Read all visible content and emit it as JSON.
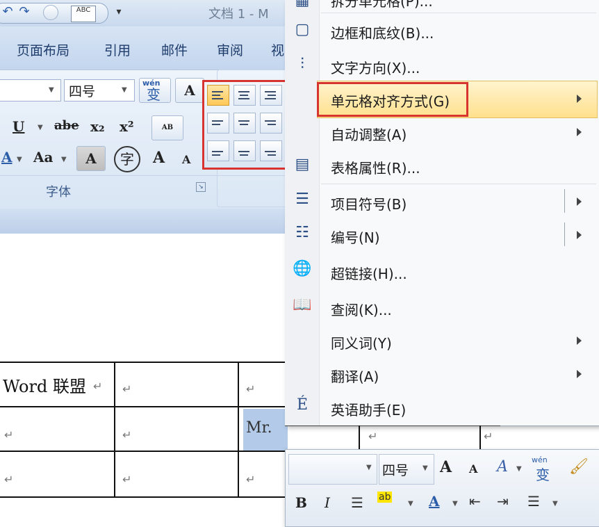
{
  "window": {
    "title": "文档 1 - M",
    "qat_undo": "↶",
    "qat_redo": "↷",
    "qat_more": "▾",
    "qat_abc": "ABC"
  },
  "tabs": [
    "页面布局",
    "引用",
    "邮件",
    "审阅",
    "视"
  ],
  "ribbon": {
    "font_size": "四号",
    "phonetic_guide": "wén",
    "phonetic_char": "变",
    "char_border": "A",
    "underline": "U",
    "strike": "abe",
    "subscript": "x₂",
    "superscript": "x²",
    "clear_format": "AB",
    "font_color_a": "A",
    "change_case": "Aa",
    "char_shading": "A",
    "enclose_char": "字",
    "grow_font": "A",
    "shrink_font": "A",
    "group_font_label": "字体"
  },
  "document": {
    "cell_word": "Word 联盟",
    "cell_mr": "Mr.",
    "para_mark": "↵"
  },
  "context_menu": {
    "items": [
      {
        "label": "拆分单元格(P)...",
        "icon": "split-cells-icon",
        "submenu": false
      },
      {
        "label": "边框和底纹(B)...",
        "icon": "borders-icon",
        "submenu": false
      },
      {
        "label": "文字方向(X)...",
        "icon": "text-direction-icon",
        "submenu": false
      },
      {
        "label": "单元格对齐方式(G)",
        "icon": "",
        "submenu": true
      },
      {
        "label": "自动调整(A)",
        "icon": "",
        "submenu": true
      },
      {
        "label": "表格属性(R)...",
        "icon": "table-properties-icon",
        "submenu": false
      },
      {
        "label": "项目符号(B)",
        "icon": "bullets-icon",
        "submenu": true
      },
      {
        "label": "编号(N)",
        "icon": "numbering-icon",
        "submenu": true
      },
      {
        "label": "超链接(H)...",
        "icon": "hyperlink-icon",
        "submenu": false
      },
      {
        "label": "查阅(K)...",
        "icon": "lookup-icon",
        "submenu": false
      },
      {
        "label": "同义词(Y)",
        "icon": "",
        "submenu": true
      },
      {
        "label": "翻译(A)",
        "icon": "",
        "submenu": true
      },
      {
        "label": "英语助手(E)",
        "icon": "english-assistant-icon",
        "submenu": false
      }
    ]
  },
  "mini_toolbar": {
    "font_size": "四号",
    "grow": "A",
    "shrink": "A",
    "styles": "A",
    "phonetic": "wén",
    "phonetic_char": "变",
    "bold": "B",
    "italic": "I",
    "font_color": "A"
  },
  "colors": {
    "highlight_border": "#d7332f",
    "menu_highlight": "#ffe08d",
    "selection": "#b3cbe9"
  }
}
